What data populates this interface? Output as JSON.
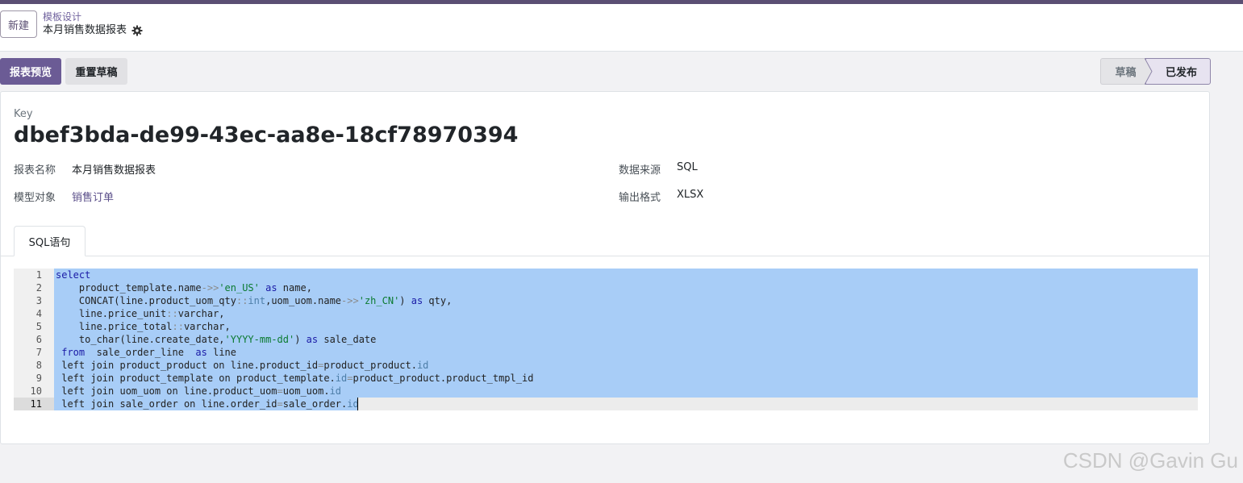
{
  "control": {
    "new_button": "新建",
    "breadcrumb": "模板设计",
    "record_title": "本月销售数据报表"
  },
  "actions": {
    "preview": "报表预览",
    "reset": "重置草稿"
  },
  "status": {
    "draft": "草稿",
    "published": "已发布",
    "current": "已发布"
  },
  "sheet": {
    "key_label": "Key",
    "key_value": "dbef3bda-de99-43ec-aa8e-18cf78970394",
    "fields": {
      "report_name_label": "报表名称",
      "report_name_value": "本月销售数据报表",
      "model_label": "模型对象",
      "model_value": "销售订单",
      "source_label": "数据来源",
      "source_value": "SQL",
      "format_label": "输出格式",
      "format_value": "XLSX"
    },
    "tab": "SQL语句"
  },
  "code": {
    "line_numbers": [
      "1",
      "2",
      "3",
      "4",
      "5",
      "6",
      "7",
      "8",
      "9",
      "10",
      "11"
    ],
    "active_line": 11
  },
  "watermark": "CSDN @Gavin Gu"
}
